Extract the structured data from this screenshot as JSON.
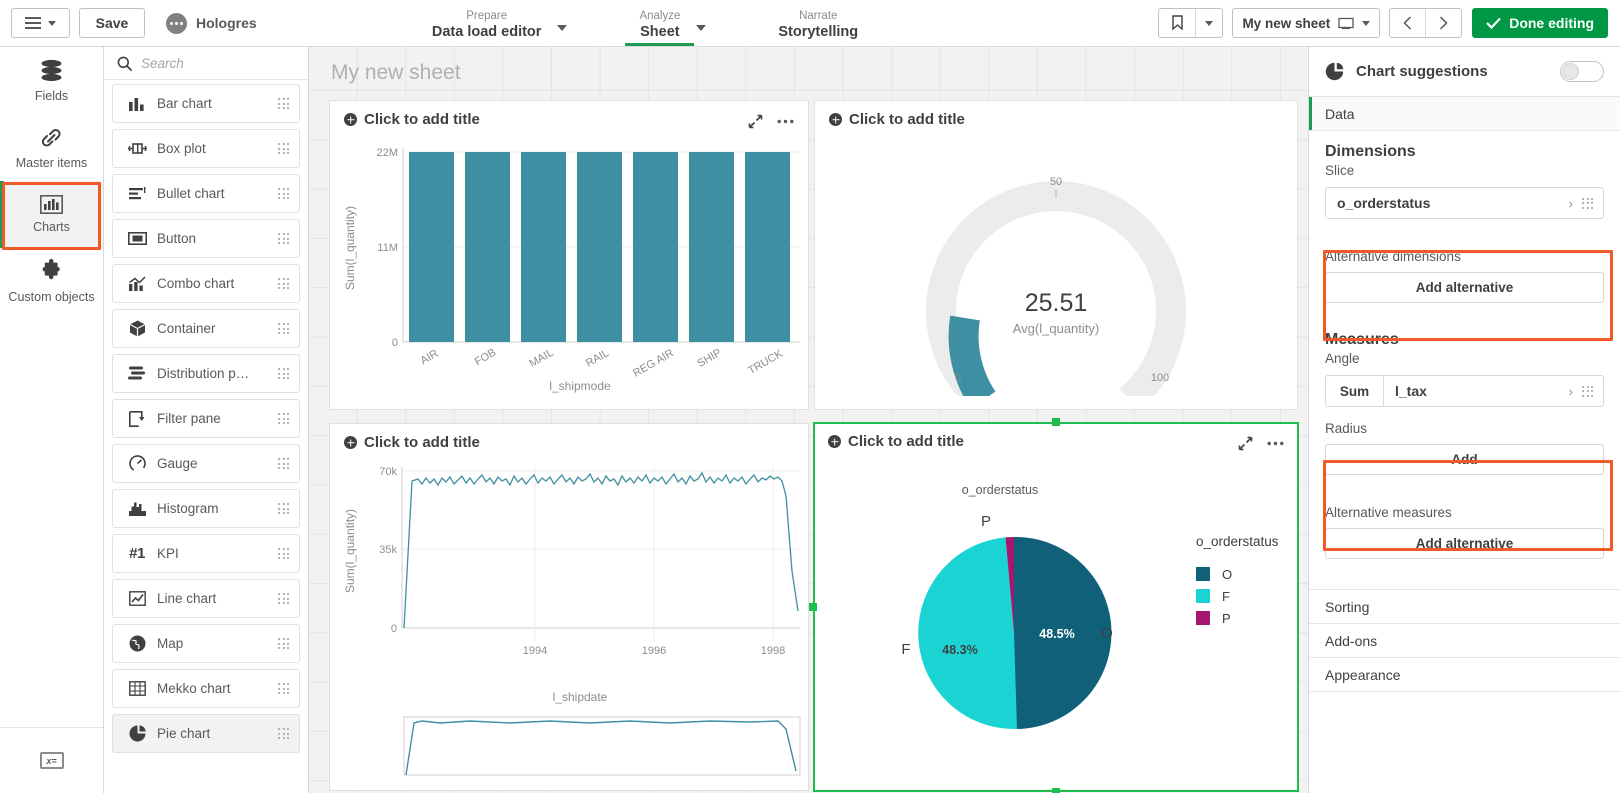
{
  "topbar": {
    "menu_icon": "hamburger-icon",
    "menu_caret_icon": "caret-down-icon",
    "save_label": "Save",
    "user_name": "Hologres",
    "avatar_icon": "user-avatar-icon",
    "nav": [
      {
        "sub": "Prepare",
        "main": "Data load editor",
        "caret": true,
        "active": false
      },
      {
        "sub": "Analyze",
        "main": "Sheet",
        "caret": true,
        "active": true
      },
      {
        "sub": "Narrate",
        "main": "Storytelling",
        "caret": false,
        "active": false
      }
    ],
    "bookmark_icon": "bookmark-icon",
    "bookmark_caret_icon": "caret-down-icon",
    "sheet_selector_label": "My new sheet",
    "sheet_selector_icon": "sheet-icon",
    "sheet_selector_caret_icon": "caret-down-icon",
    "prev_icon": "chevron-left-icon",
    "next_icon": "chevron-right-icon",
    "done_label": "Done editing",
    "done_icon": "check-icon",
    "done_color": "#009845"
  },
  "rail": {
    "items": [
      {
        "label": "Fields",
        "icon": "database-icon",
        "selected": false
      },
      {
        "label": "Master items",
        "icon": "link-icon",
        "selected": false
      },
      {
        "label": "Charts",
        "icon": "bar-chart-icon",
        "selected": true
      },
      {
        "label": "Custom objects",
        "icon": "puzzle-icon",
        "selected": false
      }
    ],
    "bottom_icon": "expression-fx-icon",
    "highlight_color": "#ef5a28"
  },
  "chartlist": {
    "search_placeholder": "Search",
    "search_value": "",
    "search_icon": "search-icon",
    "grip_icon": "drag-grip-icon",
    "items": [
      {
        "label": "Bar chart",
        "icon": "bar-chart-icon"
      },
      {
        "label": "Box plot",
        "icon": "box-plot-icon"
      },
      {
        "label": "Bullet chart",
        "icon": "bullet-chart-icon"
      },
      {
        "label": "Button",
        "icon": "button-icon"
      },
      {
        "label": "Combo chart",
        "icon": "combo-chart-icon"
      },
      {
        "label": "Container",
        "icon": "container-icon"
      },
      {
        "label": "Distribution p…",
        "icon": "distribution-plot-icon"
      },
      {
        "label": "Filter pane",
        "icon": "filter-pane-icon"
      },
      {
        "label": "Gauge",
        "icon": "gauge-icon"
      },
      {
        "label": "Histogram",
        "icon": "histogram-icon"
      },
      {
        "label": "KPI",
        "icon": "kpi-icon"
      },
      {
        "label": "Line chart",
        "icon": "line-chart-icon"
      },
      {
        "label": "Map",
        "icon": "map-icon"
      },
      {
        "label": "Mekko chart",
        "icon": "mekko-chart-icon"
      },
      {
        "label": "Pie chart",
        "icon": "pie-chart-icon"
      }
    ]
  },
  "canvas": {
    "sheet_title": "My new sheet",
    "add_title_placeholder": "Click to add title",
    "fullscreen_icon": "expand-icon",
    "more_icon": "more-options-icon",
    "selection_color": "#1ec04d"
  },
  "chart_data": [
    {
      "type": "bar",
      "title": "Click to add title",
      "categories": [
        "AIR",
        "FOB",
        "MAIL",
        "RAIL",
        "REG AIR",
        "SHIP",
        "TRUCK"
      ],
      "values": [
        22100000,
        22050000,
        22050000,
        22100000,
        22050000,
        22150000,
        22050000
      ],
      "xlabel": "l_shipmode",
      "ylabel": "Sum(l_quantity)",
      "yticks": [
        "0",
        "11M",
        "22M"
      ],
      "ylim": [
        0,
        22500000
      ],
      "color": "#3f8fa2",
      "grid": true
    },
    {
      "type": "gauge",
      "title": "Click to add title",
      "value": 25.51,
      "value_label": "25.51",
      "measure_label": "Avg(l_quantity)",
      "min": 0,
      "max": 100,
      "ticks": [
        "0",
        "50",
        "100"
      ],
      "color": "#3f8fa2",
      "track_color": "#ececec"
    },
    {
      "type": "line",
      "title": "Click to add title",
      "xlabel": "l_shipdate",
      "ylabel": "Sum(l_quantity)",
      "yticks": [
        "0",
        "35k",
        "70k"
      ],
      "xticks": [
        "1994",
        "1996",
        "1998"
      ],
      "ylim": [
        0,
        75000
      ],
      "plateau_value": 64000,
      "color": "#3f8fa2",
      "grid": true,
      "has_minichart": true
    },
    {
      "type": "pie",
      "title": "Click to add title",
      "dimension_title": "o_orderstatus",
      "legend_title": "o_orderstatus",
      "legend_position": "right",
      "categories": [
        "O",
        "F",
        "P"
      ],
      "values": [
        48.5,
        48.3,
        3.2
      ],
      "value_labels": [
        "48.5%",
        "48.3%",
        ""
      ],
      "colors": [
        "#11607a",
        "#1ad3d3",
        "#a3186e"
      ],
      "selected": true
    }
  ],
  "rightpanel": {
    "chart_suggestions_label": "Chart suggestions",
    "chart_suggestions_icon": "pie-chart-icon",
    "chart_suggestions_on": false,
    "sections": [
      {
        "label": "Data",
        "active": true
      },
      {
        "label": "Sorting",
        "active": false
      },
      {
        "label": "Add-ons",
        "active": false
      },
      {
        "label": "Appearance",
        "active": false
      }
    ],
    "dimensions": {
      "heading": "Dimensions",
      "sub": "Slice",
      "field": "o_orderstatus",
      "chevron_icon": "chevron-right-icon",
      "grip_icon": "drag-grip-icon",
      "alt_label": "Alternative dimensions",
      "alt_button": "Add alternative",
      "highlighted": true
    },
    "measures": {
      "heading": "Measures",
      "sub": "Angle",
      "aggregation": "Sum",
      "field": "l_tax",
      "chevron_icon": "chevron-right-icon",
      "grip_icon": "drag-grip-icon",
      "radius_label": "Radius",
      "radius_button": "Add",
      "alt_label": "Alternative measures",
      "alt_button": "Add alternative",
      "highlighted": true
    },
    "highlight_color": "#ef5a28"
  }
}
